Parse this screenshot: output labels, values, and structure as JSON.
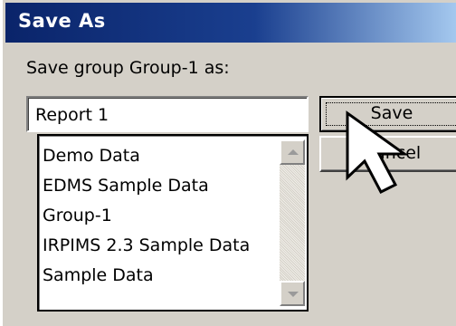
{
  "dialog": {
    "title": "Save As",
    "prompt": "Save group Group-1 as:",
    "name_input_value": "Report 1",
    "list_items": [
      "Demo Data",
      "EDMS Sample Data",
      "Group-1",
      "IRPIMS 2.3 Sample Data",
      "Sample Data"
    ],
    "save_label": "Save",
    "cancel_label": "Cancel"
  },
  "icons": {
    "cursor": "arrow-cursor-icon",
    "scroll_up": "scroll-up-arrow-icon",
    "scroll_down": "scroll-down-arrow-icon"
  },
  "colors": {
    "title_bar_start": "#0a246a",
    "title_bar_end": "#a6caf0",
    "dialog_face": "#d4d0c8"
  }
}
